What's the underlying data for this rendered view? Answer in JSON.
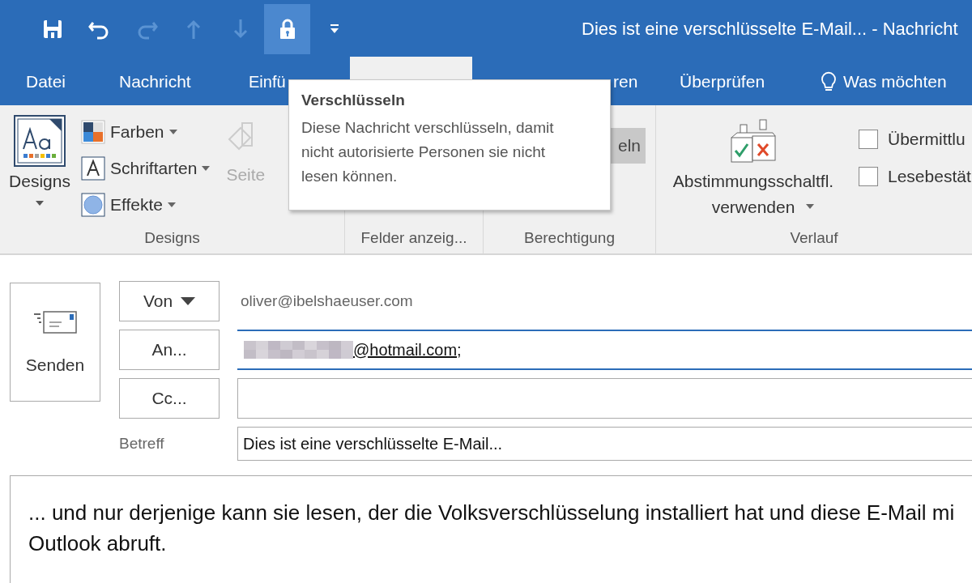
{
  "window": {
    "title": "Dies ist eine verschlüsselte E-Mail... - Nachricht"
  },
  "quick_access": [
    {
      "kind": "save",
      "disabled": false,
      "highlighted": false
    },
    {
      "kind": "undo",
      "disabled": false,
      "highlighted": false
    },
    {
      "kind": "redo",
      "disabled": true,
      "highlighted": false
    },
    {
      "kind": "up",
      "disabled": true,
      "highlighted": false
    },
    {
      "kind": "down",
      "disabled": true,
      "highlighted": false
    },
    {
      "kind": "lock",
      "disabled": false,
      "highlighted": true
    },
    {
      "kind": "customize",
      "disabled": false,
      "highlighted": false
    }
  ],
  "tabs": [
    {
      "label": "Datei",
      "selected": false
    },
    {
      "label": "Nachricht",
      "selected": false
    },
    {
      "label": "Einfü",
      "selected": false
    },
    {
      "selected": true
    },
    {
      "label": "ren",
      "selected": false
    },
    {
      "label": "Überprüfen",
      "selected": false
    },
    {
      "kind": "search",
      "label": "Was möchten",
      "selected": false
    }
  ],
  "ribbon": {
    "groups": [
      {
        "label": "Designs",
        "items": [
          {
            "kind": "designs",
            "label": "Designs"
          },
          {
            "kind": "colors",
            "label": "Farben"
          },
          {
            "kind": "fonts",
            "label": "Schriftarten"
          },
          {
            "kind": "effects",
            "label": "Effekte"
          },
          {
            "kind": "disabled",
            "label": "Seite"
          }
        ]
      },
      {
        "label": "Felder anzeig..."
      },
      {
        "label": "Berechtigung",
        "items": [
          {
            "kind": "hovered",
            "label": "eln"
          }
        ]
      },
      {
        "label": "Verlauf",
        "items": [
          {
            "kind": "vote",
            "label": "Abstimmungsschaltfl. verwenden"
          },
          {
            "kind": "checkbox",
            "label": "Übermittlu",
            "checked": false
          },
          {
            "kind": "checkbox",
            "label": "Lesebestät",
            "checked": false
          }
        ]
      }
    ]
  },
  "tooltip": {
    "title": "Verschlüsseln",
    "text": "Diese Nachricht verschlüsseln, damit nicht autorisierte Personen sie nicht lesen können."
  },
  "compose": {
    "send_button": "Senden",
    "from": {
      "button": "Von",
      "value": "oliver@ibelshaeuser.com"
    },
    "to": {
      "button": "An...",
      "value": "@hotmail.com;",
      "redacted": true,
      "focused": true
    },
    "cc": {
      "button": "Cc...",
      "focused": false
    },
    "subject": {
      "label": "Betreff",
      "value": "Dies ist eine verschlüsselte E-Mail..."
    },
    "body": [
      "... und nur derjenige kann sie lesen, der die Volksverschlüsselung installiert hat und diese E-Mail mi",
      "Outlook abruft."
    ]
  }
}
